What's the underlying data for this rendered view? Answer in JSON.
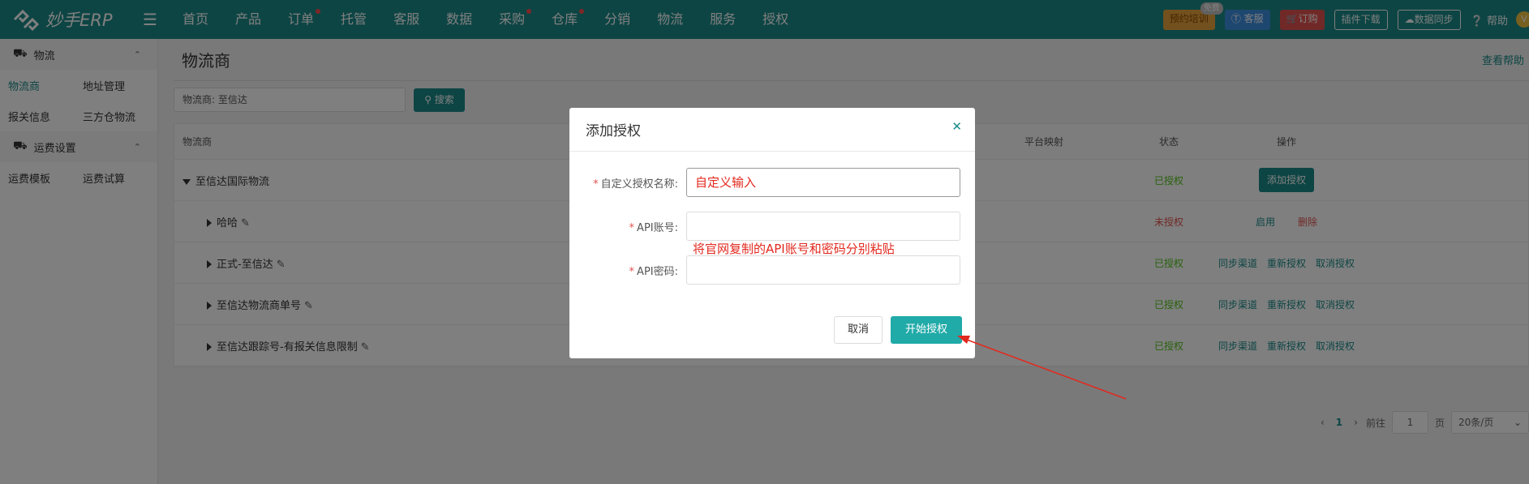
{
  "topbar": {
    "logo_text": "妙手ERP",
    "nav": [
      {
        "label": "首页",
        "dot": false
      },
      {
        "label": "产品",
        "dot": false
      },
      {
        "label": "订单",
        "dot": true
      },
      {
        "label": "托管",
        "dot": false
      },
      {
        "label": "客服",
        "dot": false
      },
      {
        "label": "数据",
        "dot": false
      },
      {
        "label": "采购",
        "dot": true
      },
      {
        "label": "仓库",
        "dot": true
      },
      {
        "label": "分销",
        "dot": false
      },
      {
        "label": "物流",
        "dot": false
      },
      {
        "label": "服务",
        "dot": false
      },
      {
        "label": "授权",
        "dot": false
      }
    ],
    "train_label": "预约培训",
    "free_badge": "免费",
    "service_label": "客服",
    "order_label": "订购",
    "plugin_label": "插件下载",
    "sync_label": "数据同步",
    "help_label": "帮助",
    "avatar_text": "V"
  },
  "sidebar": {
    "group1": "物流",
    "group1_items": [
      "物流商",
      "地址管理",
      "报关信息",
      "三方仓物流"
    ],
    "group2": "运费设置",
    "group2_items": [
      "运费模板",
      "运费试算"
    ]
  },
  "main": {
    "title": "物流商",
    "help_link": "查看帮助",
    "search_text": "物流商:  至信达",
    "search_button": "搜索",
    "columns": {
      "name": "物流商",
      "map": "平台映射",
      "status": "状态",
      "ops": "操作"
    },
    "parent_row": {
      "name": "至信达国际物流",
      "status": "已授权",
      "op": "添加授权"
    },
    "rows": [
      {
        "name": "哈哈",
        "status": "未授权",
        "status_ok": false,
        "ops": [
          "启用",
          "删除"
        ]
      },
      {
        "name": "正式-至信达",
        "status": "已授权",
        "status_ok": true,
        "ops": [
          "同步渠道",
          "重新授权",
          "取消授权"
        ]
      },
      {
        "name": "至信达物流商单号",
        "status": "已授权",
        "status_ok": true,
        "ops": [
          "同步渠道",
          "重新授权",
          "取消授权"
        ]
      },
      {
        "name": "至信达跟踪号-有报关信息限制",
        "status": "已授权",
        "status_ok": true,
        "ops": [
          "同步渠道",
          "重新授权",
          "取消授权"
        ]
      }
    ],
    "pager": {
      "page": "1",
      "goto_label": "前往",
      "goto_value": "1",
      "page_unit": "页",
      "page_size": "20条/页"
    }
  },
  "modal": {
    "title": "添加授权",
    "name_label": "自定义授权名称:",
    "name_value": "自定义输入",
    "account_label": "API账号:",
    "password_label": "API密码:",
    "note": "将官网复制的API账号和密码分别粘贴",
    "cancel_label": "取消",
    "start_label": "开始授权"
  }
}
